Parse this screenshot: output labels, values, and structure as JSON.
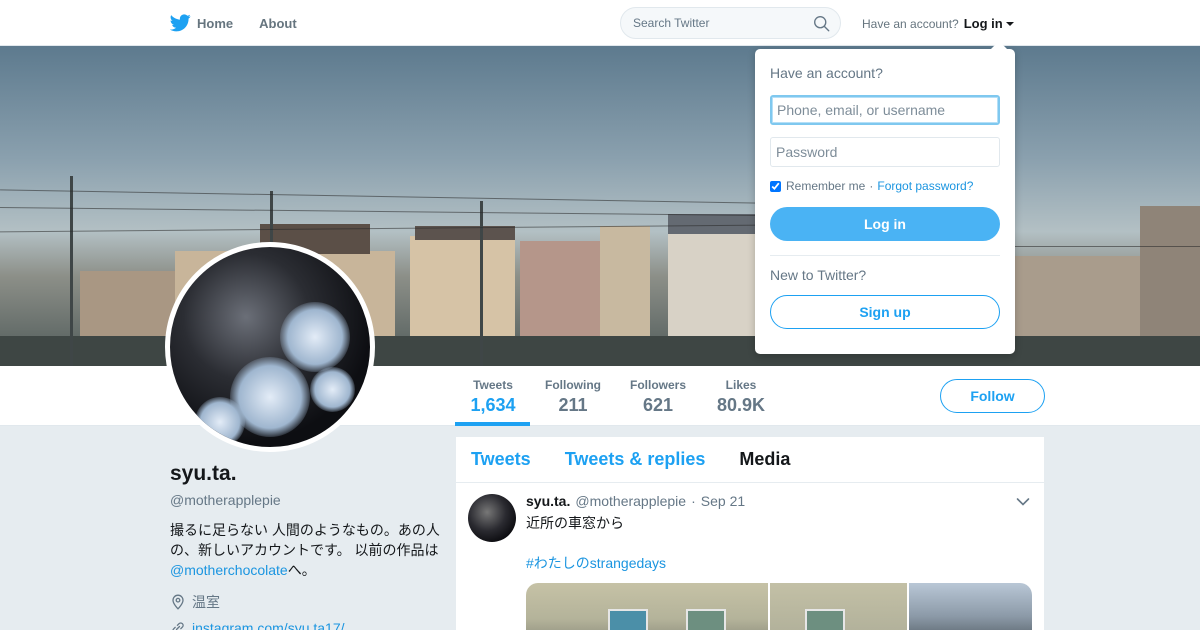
{
  "nav": {
    "home_label": "Home",
    "about_label": "About",
    "search_placeholder": "Search Twitter",
    "have_account_text": "Have an account?",
    "login_label": "Log in"
  },
  "profile_nav": {
    "stats": [
      {
        "label": "Tweets",
        "value": "1,634"
      },
      {
        "label": "Following",
        "value": "211"
      },
      {
        "label": "Followers",
        "value": "621"
      },
      {
        "label": "Likes",
        "value": "80.9K"
      }
    ],
    "follow_label": "Follow"
  },
  "profile": {
    "name": "syu.ta.",
    "handle": "@motherapplepie",
    "bio_text": "撮るに足らない 人間のようなもの。あの人の、新しいアカウントです。 以前の作品は",
    "bio_mention": "@motherchocolate",
    "bio_suffix": "へ。",
    "location": "温室",
    "website": "instagram.com/syu.ta17/"
  },
  "timeline": {
    "tabs": [
      "Tweets",
      "Tweets & replies",
      "Media"
    ],
    "tweet": {
      "name": "syu.ta.",
      "handle": "@motherapplepie",
      "separator": "·",
      "time": "Sep 21",
      "text": "近所の車窓から",
      "hashtag": "#わたしのstrangedays"
    }
  },
  "login_dropdown": {
    "title": "Have an account?",
    "username_placeholder": "Phone, email, or username",
    "password_placeholder": "Password",
    "remember_label": "Remember me",
    "separator": "·",
    "forgot_label": "Forgot password?",
    "login_button": "Log in",
    "new_text": "New to Twitter?",
    "signup_button": "Sign up"
  },
  "colors": {
    "brand_blue": "#1da1f2",
    "link_blue": "#1b95e0",
    "muted_gray": "#657786",
    "page_bg": "#e6ecf0"
  },
  "icons": [
    "twitter-bird-icon",
    "search-icon",
    "location-pin-icon",
    "link-icon",
    "chevron-down-icon"
  ]
}
